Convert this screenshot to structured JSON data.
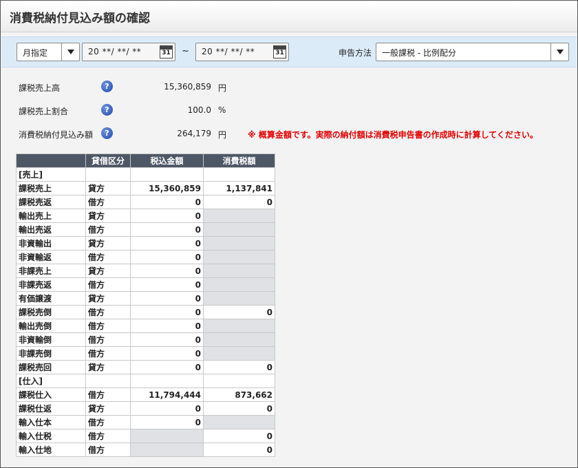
{
  "title": "消費税納付見込み額の確認",
  "toolbar": {
    "period_select": "月指定",
    "date_from": "20 **/ **/ **",
    "date_to": "20 **/ **/ **",
    "calendar_day": "31",
    "range_sep": "~",
    "method_label": "申告方法",
    "method_select": "一般課税 - 比例配分"
  },
  "summary": [
    {
      "label": "課税売上高",
      "value": "15,360,859",
      "unit": "円"
    },
    {
      "label": "課税売上割合",
      "value": "100.0",
      "unit": "%"
    },
    {
      "label": "消費税納付見込み額",
      "value": "264,179",
      "unit": "円"
    }
  ],
  "note": "※ 概算金額です。実際の納付額は消費税申告書の作成時に計算してください。",
  "help_glyph": "?",
  "table": {
    "headers": [
      "",
      "貸借区分",
      "税込金額",
      "消費税額"
    ],
    "rows": [
      {
        "item": "[売上]",
        "section": true
      },
      {
        "item": "課税売上",
        "side": "貸方",
        "amount": "15,360,859",
        "tax": "1,137,841"
      },
      {
        "item": "課税売返",
        "side": "借方",
        "amount": "0",
        "tax": "0"
      },
      {
        "item": "輸出売上",
        "side": "貸方",
        "amount": "0",
        "tax": null
      },
      {
        "item": "輸出売返",
        "side": "借方",
        "amount": "0",
        "tax": null
      },
      {
        "item": "非資輸出",
        "side": "貸方",
        "amount": "0",
        "tax": null
      },
      {
        "item": "非資輸返",
        "side": "借方",
        "amount": "0",
        "tax": null
      },
      {
        "item": "非課売上",
        "side": "貸方",
        "amount": "0",
        "tax": null
      },
      {
        "item": "非課売返",
        "side": "借方",
        "amount": "0",
        "tax": null
      },
      {
        "item": "有価譲渡",
        "side": "貸方",
        "amount": "0",
        "tax": null
      },
      {
        "item": "課税売倒",
        "side": "借方",
        "amount": "0",
        "tax": "0"
      },
      {
        "item": "輸出売倒",
        "side": "借方",
        "amount": "0",
        "tax": null
      },
      {
        "item": "非資輸倒",
        "side": "借方",
        "amount": "0",
        "tax": null
      },
      {
        "item": "非課売倒",
        "side": "借方",
        "amount": "0",
        "tax": null
      },
      {
        "item": "課税売回",
        "side": "貸方",
        "amount": "0",
        "tax": "0"
      },
      {
        "item": "[仕入]",
        "section": true
      },
      {
        "item": "課税仕入",
        "side": "借方",
        "amount": "11,794,444",
        "tax": "873,662"
      },
      {
        "item": "課税仕返",
        "side": "貸方",
        "amount": "0",
        "tax": "0"
      },
      {
        "item": "輸入仕本",
        "side": "借方",
        "amount": "0",
        "tax": null
      },
      {
        "item": "輸入仕税",
        "side": "借方",
        "amount": null,
        "tax": "0"
      },
      {
        "item": "輸入仕地",
        "side": "借方",
        "amount": null,
        "tax": "0"
      }
    ]
  }
}
